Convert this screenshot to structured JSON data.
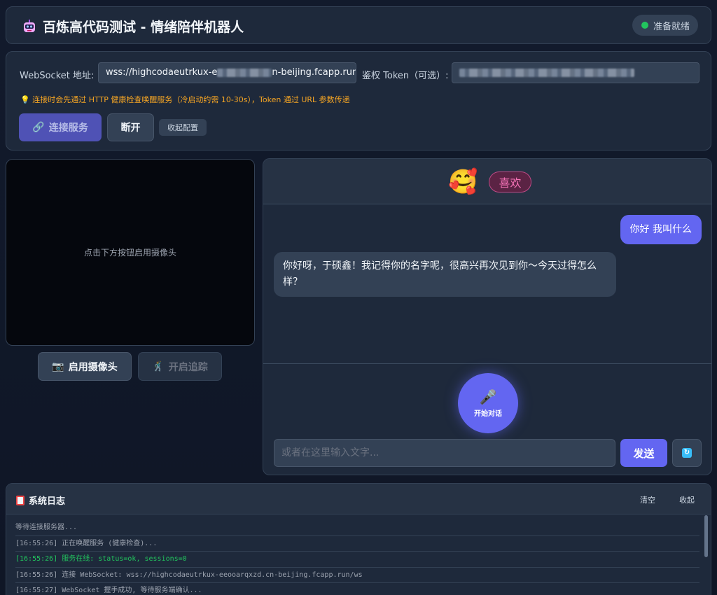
{
  "header": {
    "title": "百炼高代码测试 - 情绪陪伴机器人",
    "status": "准备就绪",
    "status_color": "#22c55e"
  },
  "config": {
    "ws_label": "WebSocket 地址:",
    "ws_value_start": "wss://highcodaeutrkux-e",
    "ws_value_end": "n-beijing.fcapp.run/ws",
    "token_label": "鉴权 Token（可选）:",
    "tip": "连接时会先通过 HTTP 健康检查唤醒服务（冷启动约需 10-30s），Token 通过 URL 参数传递",
    "connect_label": "连接服务",
    "disconnect_label": "断开",
    "collapse_label": "收起配置"
  },
  "camera": {
    "placeholder": "点击下方按钮启用摄像头",
    "enable_label": "启用摄像头",
    "track_label": "开启追踪"
  },
  "chat": {
    "emotion_emoji": "🥰",
    "emotion_label": "喜欢",
    "messages": [
      {
        "role": "user",
        "text": "你好 我叫什么"
      },
      {
        "role": "bot",
        "text": "你好呀，于硕鑫！我记得你的名字呢，很高兴再次见到你～今天过得怎么样？"
      }
    ],
    "mic_label": "开始对话",
    "input_placeholder": "或者在这里输入文字...",
    "send_label": "发送",
    "accent_color": "#6366f1"
  },
  "log": {
    "title": "系统日志",
    "clear_label": "清空",
    "collapse_label": "收起",
    "lines": [
      {
        "text": "等待连接服务器...",
        "status": "info"
      },
      {
        "text": "[16:55:26] 正在唤醒服务 (健康检查)...",
        "status": "info"
      },
      {
        "text": "[16:55:26] 服务在线: status=ok, sessions=0",
        "status": "ok"
      },
      {
        "text": "[16:55:26] 连接 WebSocket: wss://highcodaeutrkux-eeooarqxzd.cn-beijing.fcapp.run/ws",
        "status": "info"
      },
      {
        "text": "[16:55:27] WebSocket 握手成功, 等待服务端确认...",
        "status": "info"
      }
    ]
  }
}
